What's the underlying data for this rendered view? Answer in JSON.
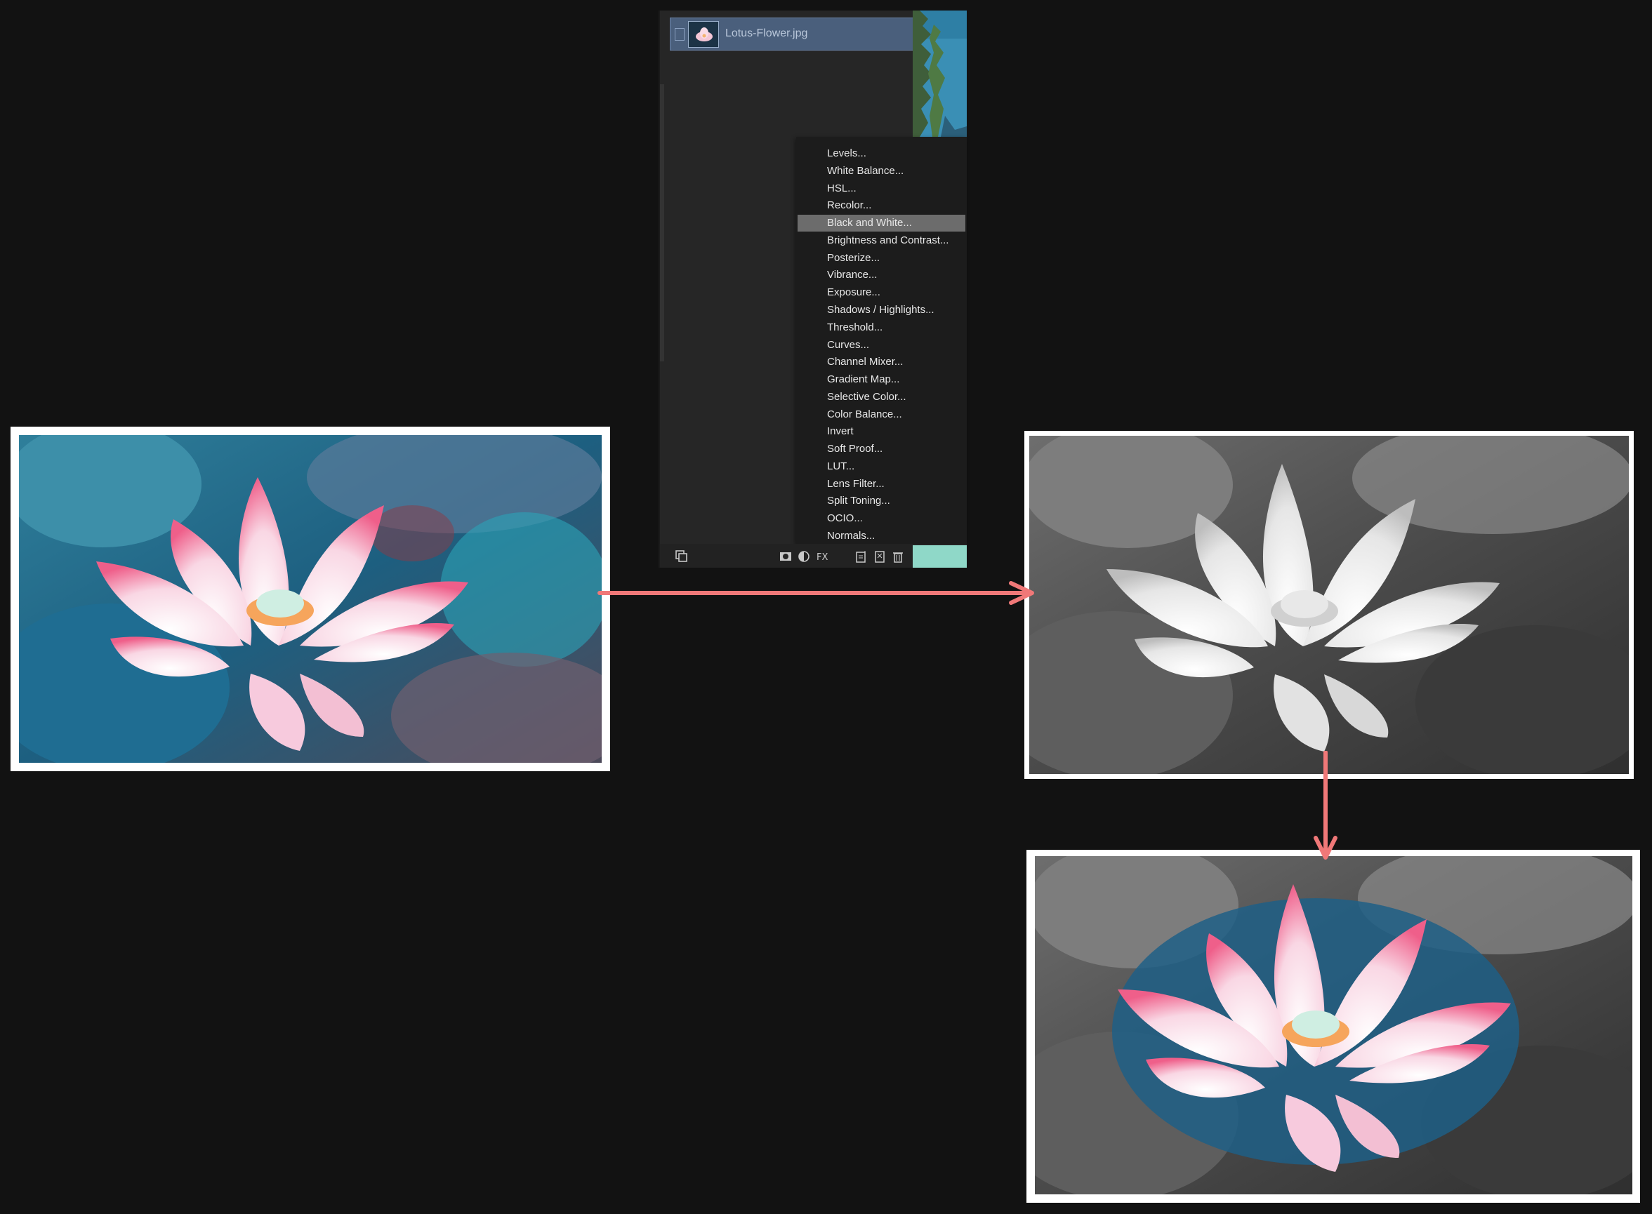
{
  "layers_panel": {
    "layer_name": "Lotus-Flower.jpg",
    "adjustments_menu": {
      "items": [
        "Levels...",
        "White Balance...",
        "HSL...",
        "Recolor...",
        "Black and White...",
        "Brightness and Contrast...",
        "Posterize...",
        "Vibrance...",
        "Exposure...",
        "Shadows / Highlights...",
        "Threshold...",
        "Curves...",
        "Channel Mixer...",
        "Gradient Map...",
        "Selective Color...",
        "Color Balance...",
        "Invert",
        "Soft Proof...",
        "LUT...",
        "Lens Filter...",
        "Split Toning...",
        "OCIO...",
        "Normals..."
      ],
      "highlighted": "Black and White..."
    },
    "footer_icons": [
      "layers-icon",
      "mask-icon",
      "adjustment-icon",
      "fx-icon",
      "new-layer-icon",
      "group-icon",
      "trash-icon"
    ]
  },
  "images": {
    "original": "color lotus photo",
    "black_and_white": "grayscale lotus photo",
    "result": "grayscale background with painted-back color lotus"
  },
  "colors": {
    "arrow": "#f07878",
    "highlight": "#6c6c6c",
    "layer_selected": "#4a5f7c"
  }
}
